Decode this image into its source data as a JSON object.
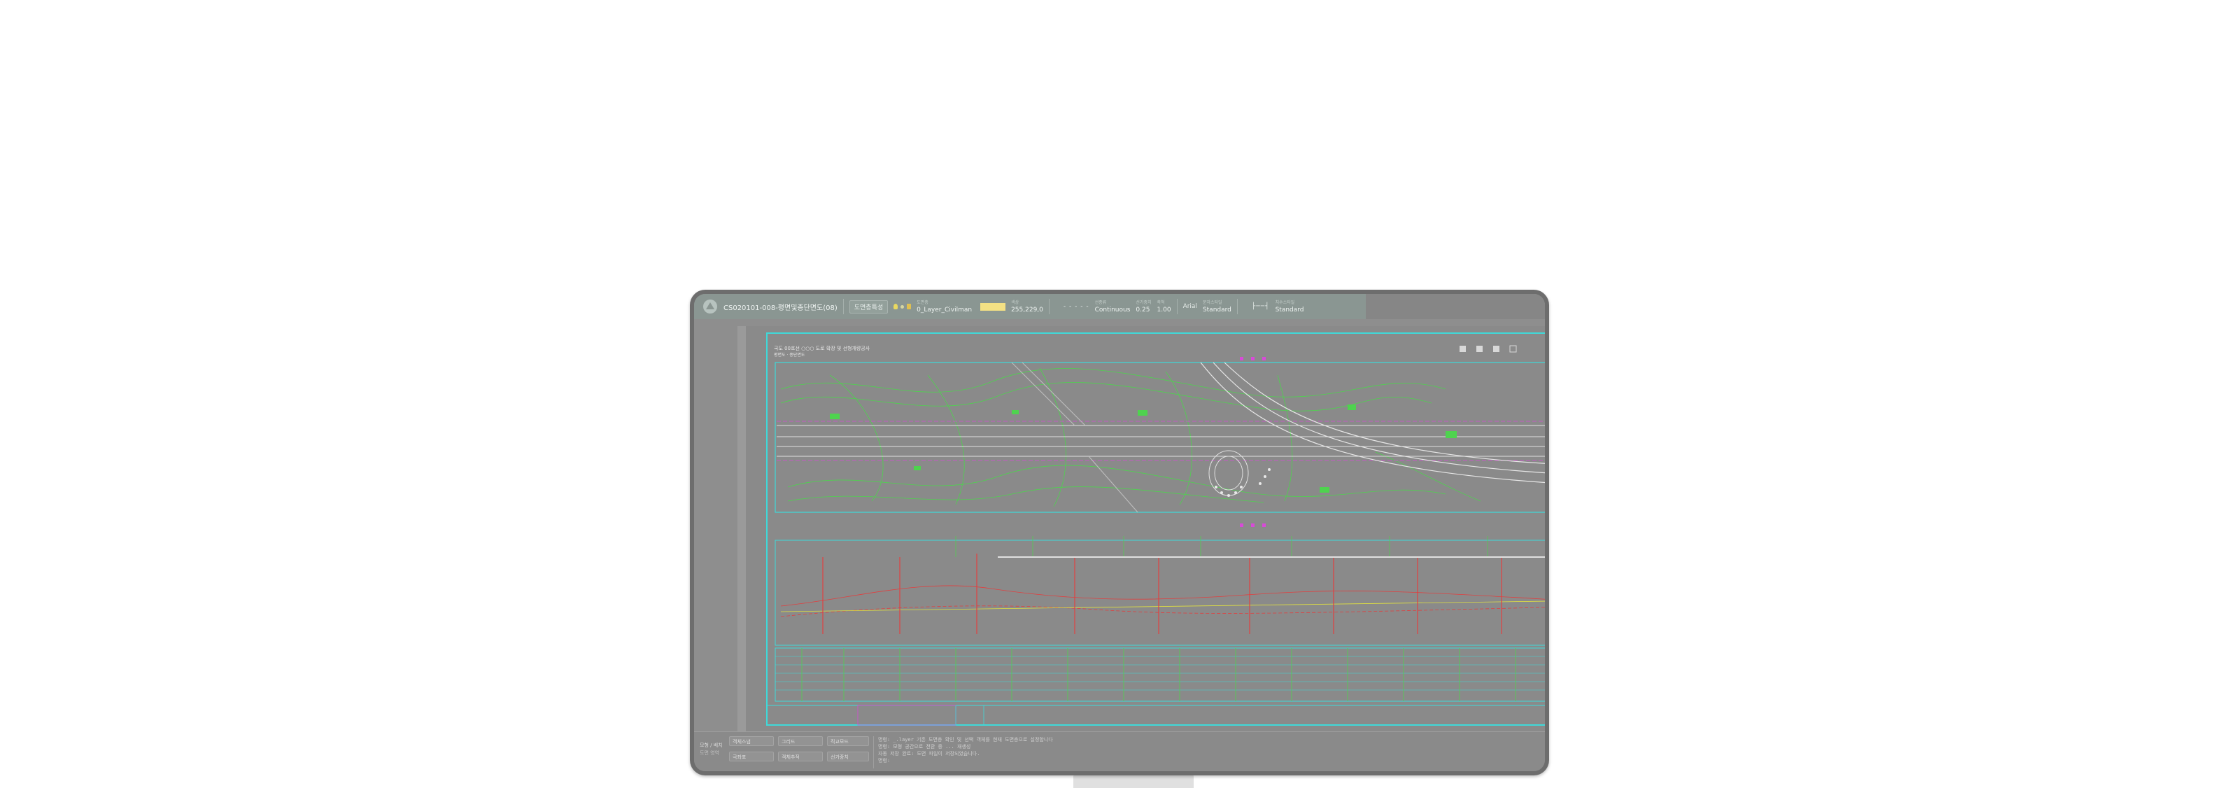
{
  "app": {
    "file_title": "CS020101-008-평면및종단면도(08)"
  },
  "ribbon": {
    "layer_button_label": "도면층특성",
    "layer": {
      "caption": "도면층",
      "value": "0_Layer_Civilman"
    },
    "color": {
      "caption": "색상",
      "value": "255,229,0",
      "swatch_color": "#f4e184"
    },
    "linetype": {
      "caption": "선종류",
      "value": "Continuous",
      "pattern": "- - - - -"
    },
    "lineweight": {
      "caption": "선가중치",
      "value": "0.25"
    },
    "scale": {
      "caption": "축척",
      "value": "1.00"
    },
    "text_style": {
      "label": "Arial",
      "caption": "문자스타일",
      "value": "Standard"
    },
    "dim_style": {
      "caption": "치수스타일",
      "value": "Standard",
      "pattern": "├──┤"
    }
  },
  "drawing": {
    "title_line1": "국도 00호선 ○○○ 도로 확장 및 선형개량공사",
    "title_line2": "평면도 · 종단면도",
    "colors": {
      "frame": "#3fd9d9",
      "lines": "#4ed34e",
      "road": "#e0e0e0",
      "accent": "#d84ad8",
      "red": "#e04040",
      "yellow": "#e0e040"
    }
  },
  "status_bar": {
    "mode_label": "모형 / 배치",
    "mode_sub": "도면 영역",
    "buttons": [
      "객체스냅",
      "그리드",
      "직교모드",
      "극좌표",
      "객체추적",
      "선가중치"
    ],
    "command_lines": [
      "명령: _.layer 기존 도면층 확인 및 선택 객체를 현재 도면층으로 설정합니다",
      "명령: 모형 공간으로 전환 중 ... 재생성",
      "자동 저장 완료: 도면 파일이 저장되었습니다.",
      "명령:"
    ]
  }
}
